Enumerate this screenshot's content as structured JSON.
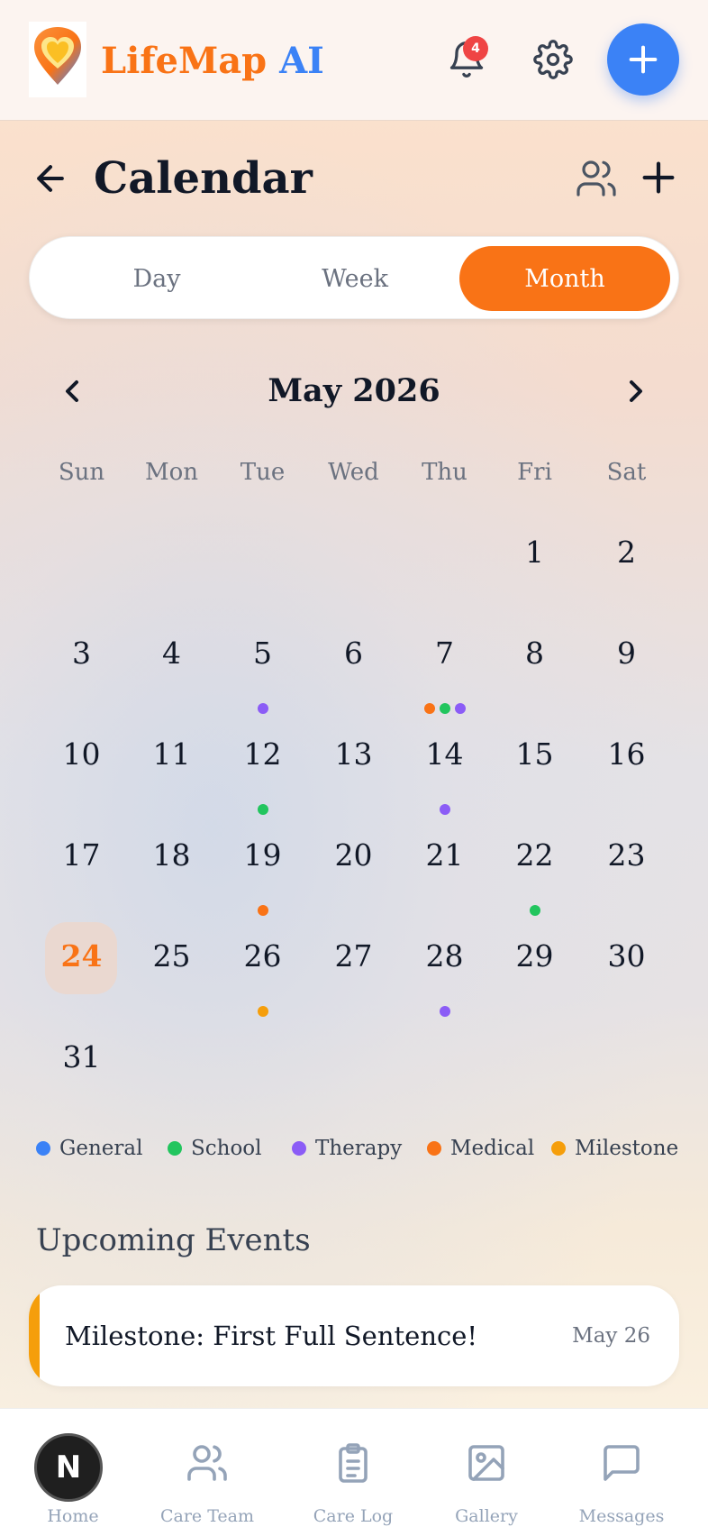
{
  "header": {
    "brand_part1": "LifeMap",
    "brand_part2": "AI",
    "notification_count": "4",
    "colors": {
      "orange": "#f97316",
      "blue": "#3b82f6"
    }
  },
  "page": {
    "title": "Calendar"
  },
  "view_toggle": {
    "options": [
      "Day",
      "Week",
      "Month"
    ],
    "selected": "Month"
  },
  "calendar": {
    "month_label": "May 2026",
    "weekdays": [
      "Sun",
      "Mon",
      "Tue",
      "Wed",
      "Thu",
      "Fri",
      "Sat"
    ],
    "today": "24",
    "weeks": [
      [
        "",
        "",
        "",
        "",
        "",
        "1",
        "2"
      ],
      [
        "3",
        "4",
        "5",
        "6",
        "7",
        "8",
        "9"
      ],
      [
        "10",
        "11",
        "12",
        "13",
        "14",
        "15",
        "16"
      ],
      [
        "17",
        "18",
        "19",
        "20",
        "21",
        "22",
        "23"
      ],
      [
        "24",
        "25",
        "26",
        "27",
        "28",
        "29",
        "30"
      ],
      [
        "31",
        "",
        "",
        "",
        "",
        "",
        ""
      ]
    ],
    "event_dots": {
      "5": [
        "therapy"
      ],
      "7": [
        "medical",
        "school",
        "therapy"
      ],
      "12": [
        "school"
      ],
      "14": [
        "therapy"
      ],
      "19": [
        "medical"
      ],
      "22": [
        "school"
      ],
      "26": [
        "milestone"
      ],
      "28": [
        "therapy"
      ]
    }
  },
  "legend": [
    {
      "key": "general",
      "label": "General",
      "color": "#3b82f6"
    },
    {
      "key": "school",
      "label": "School",
      "color": "#22c55e"
    },
    {
      "key": "therapy",
      "label": "Therapy",
      "color": "#8b5cf6"
    },
    {
      "key": "medical",
      "label": "Medical",
      "color": "#f97316"
    },
    {
      "key": "milestone",
      "label": "Milestone",
      "color": "#f59e0b"
    }
  ],
  "upcoming": {
    "heading": "Upcoming Events",
    "events": [
      {
        "title": "Milestone: First Full Sentence!",
        "date": "May 26",
        "category": "milestone"
      }
    ]
  },
  "bottom_nav": {
    "items": [
      {
        "label": "Home",
        "icon": "home-icon"
      },
      {
        "label": "Care Team",
        "icon": "users-icon"
      },
      {
        "label": "Care Log",
        "icon": "clipboard-icon"
      },
      {
        "label": "Gallery",
        "icon": "image-icon"
      },
      {
        "label": "Messages",
        "icon": "message-icon"
      }
    ],
    "avatar_letter": "N"
  }
}
